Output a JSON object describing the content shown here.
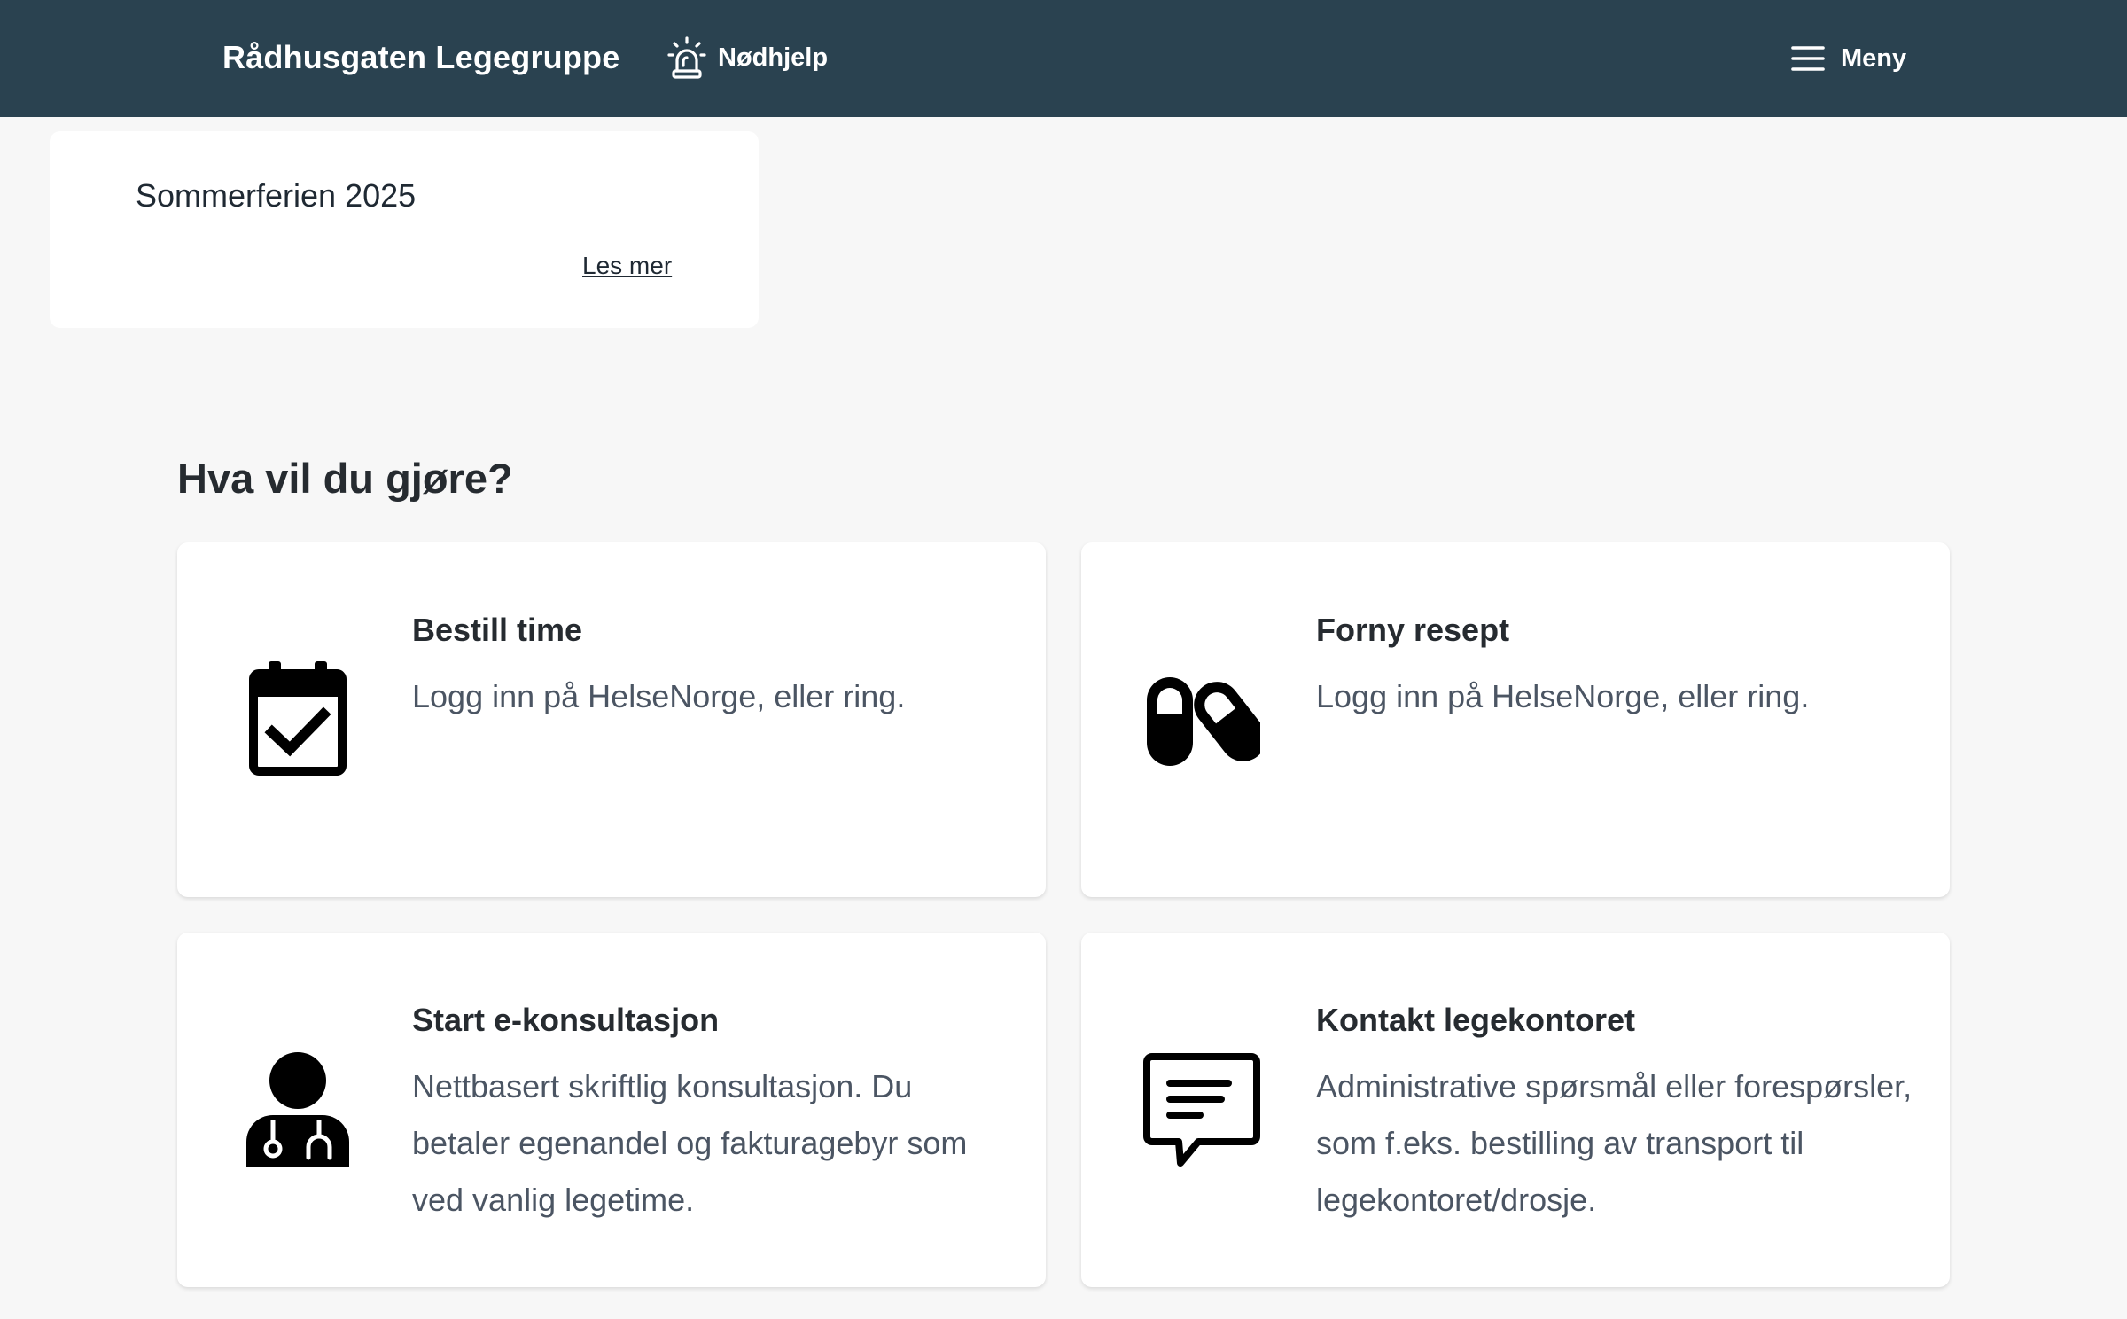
{
  "header": {
    "brand": "Rådhusgaten Legegruppe",
    "emergency_label": "Nødhjelp",
    "emergency_icon": "siren-icon",
    "menu_label": "Meny",
    "menu_icon": "hamburger-icon",
    "background": "#2a4250"
  },
  "notice": {
    "title": "Sommerferien 2025",
    "link": "Les mer"
  },
  "section": {
    "title": "Hva vil du gjøre?"
  },
  "cards": [
    {
      "icon": "calendar-check-icon",
      "title": "Bestill time",
      "description": "Logg inn på HelseNorge, eller ring."
    },
    {
      "icon": "pills-icon",
      "title": "Forny resept",
      "description": "Logg inn på HelseNorge, eller ring."
    },
    {
      "icon": "doctor-icon",
      "title": "Start e-konsultasjon",
      "description": "Nettbasert skriftlig konsultasjon. Du betaler egenandel og fakturagebyr som ved vanlig legetime."
    },
    {
      "icon": "chat-message-icon",
      "title": "Kontakt legekontoret",
      "description": "Administrative spørsmål eller forespørsler, som f.eks. bestilling av transport til legekontoret/drosje."
    }
  ]
}
